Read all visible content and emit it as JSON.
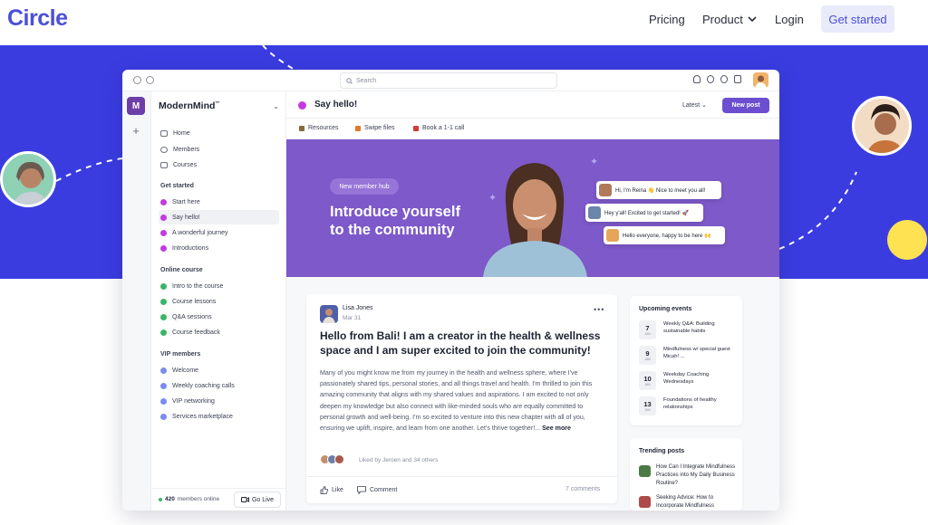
{
  "site": {
    "logo": "Circle",
    "nav": {
      "pricing": "Pricing",
      "product": "Product",
      "login": "Login",
      "cta": "Get started"
    },
    "colors": {
      "brand": "#4b4fd8",
      "band": "#3a3ce0",
      "accent_yellow": "#ffe251"
    }
  },
  "app": {
    "search_placeholder": "Search",
    "community_initial": "M",
    "community_name": "ModernMind",
    "community_tm": "™",
    "nav": [
      {
        "label": "Home",
        "icon": "home-icon"
      },
      {
        "label": "Members",
        "icon": "members-icon"
      },
      {
        "label": "Courses",
        "icon": "courses-icon"
      }
    ],
    "sections": [
      {
        "title": "Get started",
        "color": "#c13ce0",
        "items": [
          "Start here",
          "Say hello!",
          "A wonderful journey",
          "Introductions"
        ]
      },
      {
        "title": "Online course",
        "color": "#3ab56a",
        "items": [
          "Intro to the course",
          "Course lessons",
          "Q&A sessions",
          "Course feedback"
        ]
      },
      {
        "title": "VIP members",
        "color": "#7b8cf0",
        "items": [
          "Welcome",
          "Weekly coaching calls",
          "VIP networking",
          "Services marketplace"
        ]
      }
    ],
    "footer": {
      "online_count": "420",
      "online_text": "members online",
      "go_live": "Go Live"
    }
  },
  "channel": {
    "title": "Say hello!",
    "sort": "Latest",
    "new_post": "New post",
    "links": [
      {
        "label": "Resources",
        "color": "#8a6a3a"
      },
      {
        "label": "Swipe files",
        "color": "#e07a2a"
      },
      {
        "label": "Book a 1-1 call",
        "color": "#d33a3a"
      }
    ]
  },
  "banner": {
    "pill": "New member hub",
    "title_line1": "Introduce yourself",
    "title_line2": "to the community",
    "chats": [
      "Hi, I'm Reina 👋 Nice to meet you all!",
      "Hey y'all! Excited to get started! 🚀",
      "Hello everyone, happy to be here 🙌"
    ]
  },
  "post": {
    "author": "Lisa Jones",
    "date": "Mar 31",
    "more": "•••",
    "title": "Hello from Bali! I am a creator in the health & wellness space and I am super excited to join the community!",
    "body": "Many of you might know me from my journey in the health and wellness sphere, where I've passionately shared tips, personal stories, and all things travel and health. I'm thrilled to join this amazing community that aligns with my shared values and aspirations. I am excited to not only deepen my knowledge but also connect with like-minded souls who are equally committed to personal growth and well-being. I'm so excited to venture into this new chapter with all of you, ensuring we uplift, inspire, and learn from one another. Let's thrive together!...",
    "see_more": "See more",
    "liked_by": "Liked by Jeroen and 34 others",
    "like": "Like",
    "comment": "Comment",
    "comments_count": "7 comments"
  },
  "events": {
    "title": "Upcoming events",
    "items": [
      {
        "day": "7",
        "mon": "JAN",
        "text": "Weekly Q&A: Building sustainable habits"
      },
      {
        "day": "9",
        "mon": "JAN",
        "text": "Mindfulness w/ special guest Micah! ..."
      },
      {
        "day": "10",
        "mon": "JAN",
        "text": "Weekday Coaching Wednesdays"
      },
      {
        "day": "13",
        "mon": "JAN",
        "text": "Foundations of healthy relationships"
      }
    ]
  },
  "trending": {
    "title": "Trending posts",
    "items": [
      {
        "text": "How Can I Integrate Mindfulness Practices into My Daily Business Routine?",
        "color": "#4c7a45"
      },
      {
        "text": "Seeking Advice: How to Incorporate Mindfulness",
        "color": "#b04a4a"
      }
    ]
  }
}
